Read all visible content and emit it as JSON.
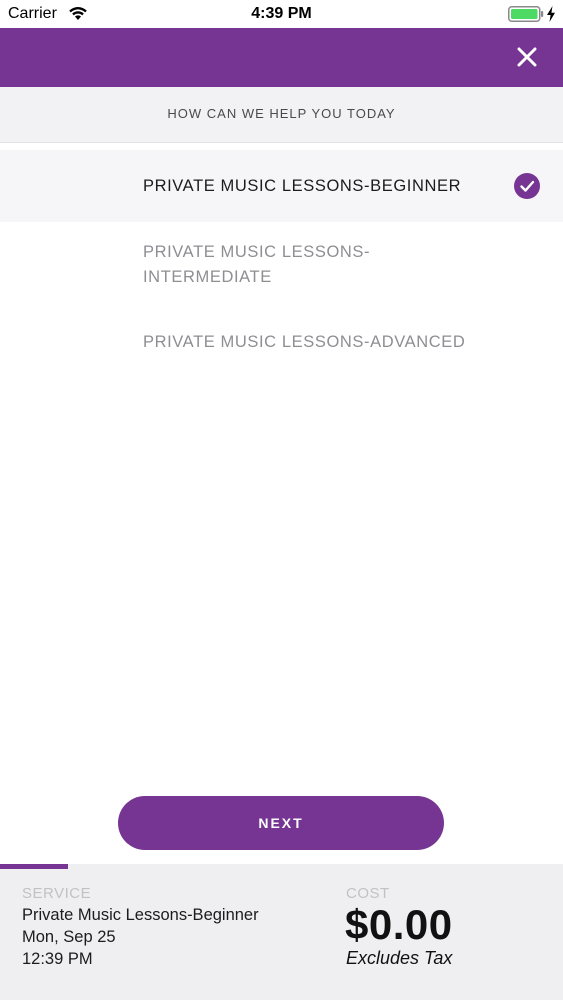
{
  "status_bar": {
    "carrier": "Carrier",
    "time": "4:39 PM",
    "icons": [
      "wifi-icon",
      "battery-icon",
      "charging-bolt-icon"
    ]
  },
  "header": {
    "close_icon": "close-icon",
    "accent_color": "#773593"
  },
  "subheader": {
    "title": "HOW CAN WE HELP YOU TODAY"
  },
  "options": [
    {
      "label": "PRIVATE MUSIC LESSONS-BEGINNER",
      "selected": true
    },
    {
      "label": "PRIVATE MUSIC LESSONS-INTERMEDIATE",
      "selected": false
    },
    {
      "label": "PRIVATE MUSIC LESSONS-ADVANCED",
      "selected": false
    }
  ],
  "next_button": {
    "label": "NEXT"
  },
  "footer": {
    "progress_fraction": 0.12,
    "service_caption": "SERVICE",
    "service_name": "Private Music Lessons-Beginner",
    "service_date": "Mon, Sep 25",
    "service_time": "12:39 PM",
    "cost_caption": "COST",
    "cost_value": "$0.00",
    "cost_note": "Excludes Tax"
  }
}
